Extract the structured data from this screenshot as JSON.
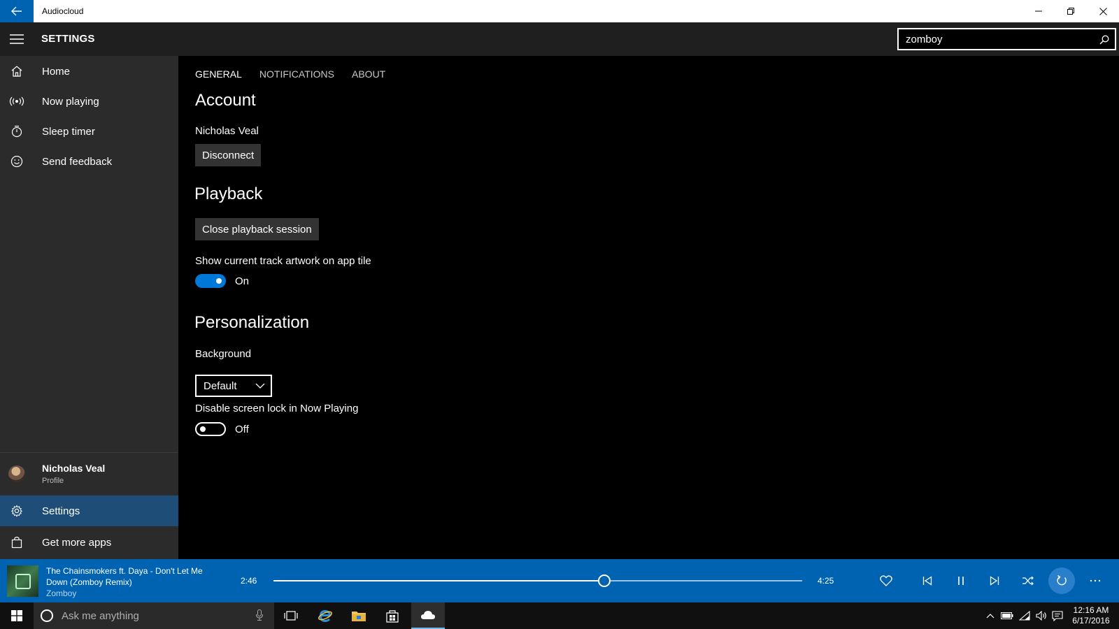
{
  "window": {
    "title": "Audiocloud"
  },
  "header": {
    "title": "SETTINGS"
  },
  "search": {
    "value": "zomboy"
  },
  "sidebar": {
    "items": [
      {
        "label": "Home",
        "icon": "home-icon"
      },
      {
        "label": "Now playing",
        "icon": "broadcast-icon"
      },
      {
        "label": "Sleep timer",
        "icon": "timer-icon"
      },
      {
        "label": "Send feedback",
        "icon": "smiley-icon"
      }
    ],
    "profile": {
      "name": "Nicholas Veal",
      "subtitle": "Profile"
    },
    "settings_label": "Settings",
    "more_apps_label": "Get more apps"
  },
  "main": {
    "tabs": [
      "GENERAL",
      "NOTIFICATIONS",
      "ABOUT"
    ],
    "active_tab": "GENERAL",
    "account": {
      "title": "Account",
      "user": "Nicholas Veal",
      "disconnect_label": "Disconnect"
    },
    "playback": {
      "title": "Playback",
      "close_session_label": "Close playback session",
      "artwork_toggle_label": "Show current track artwork on app tile",
      "artwork_toggle_state": "On"
    },
    "personalization": {
      "title": "Personalization",
      "background_label": "Background",
      "background_value": "Default",
      "screen_lock_label": "Disable screen lock in Now Playing",
      "screen_lock_state": "Off"
    }
  },
  "player": {
    "track_title": "The Chainsmokers ft. Daya - Don't Let Me Down (Zomboy Remix)",
    "artist": "Zomboy",
    "current_time": "2:46",
    "total_time": "4:25",
    "progress": 0.626
  },
  "taskbar": {
    "search_placeholder": "Ask me anything",
    "time": "12:16 AM",
    "date": "6/17/2016"
  },
  "colors": {
    "accent": "#0063b1",
    "toggle_on": "#0078d7",
    "sidebar_bg": "#2b2b2b",
    "active_nav": "#1e4d78"
  }
}
